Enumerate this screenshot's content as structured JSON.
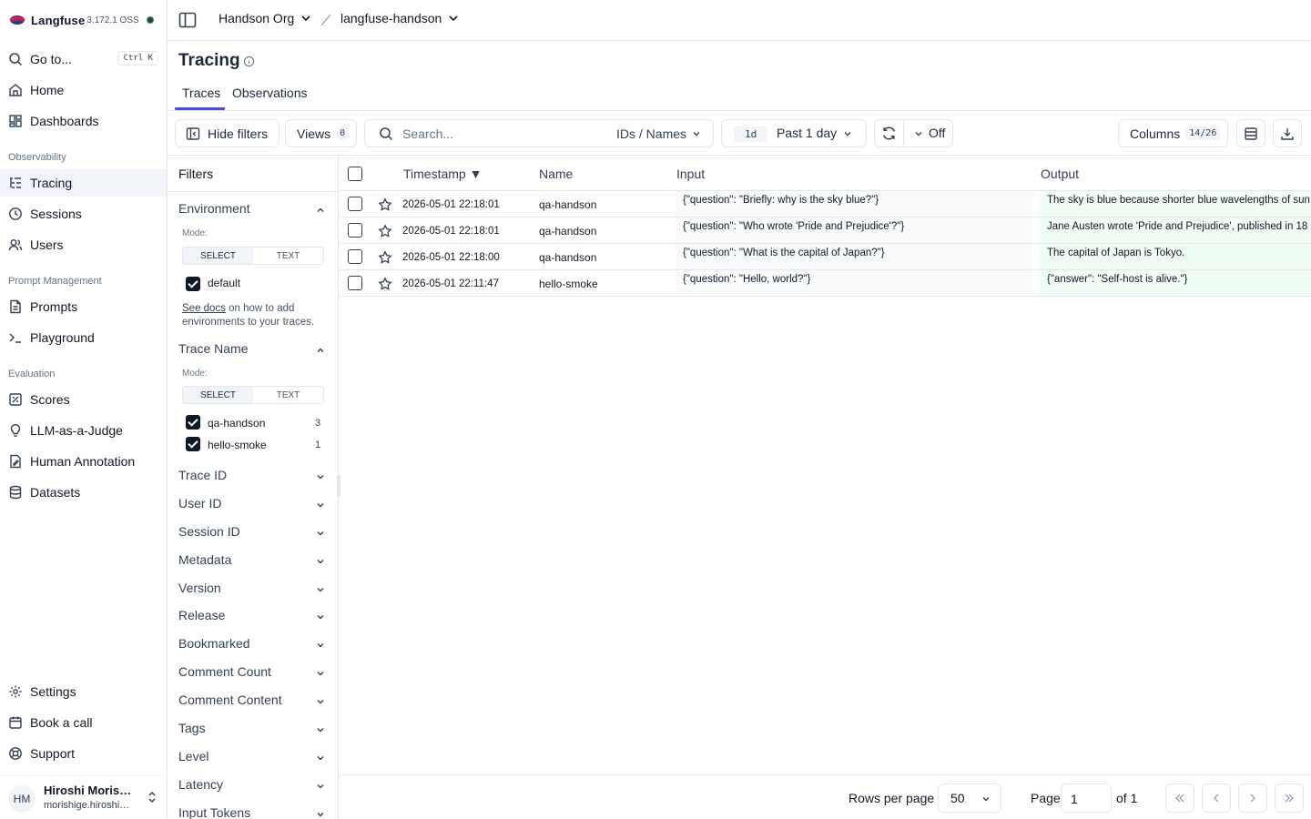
{
  "brand": {
    "name": "Langfuse",
    "version": "3.172.1 OSS"
  },
  "sidebar": {
    "goto": {
      "label": "Go to...",
      "shortcut": "Ctrl K"
    },
    "items_top": [
      {
        "label": "Home",
        "icon": "home-icon"
      },
      {
        "label": "Dashboards",
        "icon": "dashboard-icon"
      }
    ],
    "sections": {
      "observability": "Observability",
      "prompt_management": "Prompt Management",
      "evaluation": "Evaluation"
    },
    "observability": [
      {
        "label": "Tracing",
        "icon": "tracing-icon",
        "active": true
      },
      {
        "label": "Sessions",
        "icon": "clock-icon"
      },
      {
        "label": "Users",
        "icon": "users-icon"
      }
    ],
    "prompt_management": [
      {
        "label": "Prompts",
        "icon": "file-icon"
      },
      {
        "label": "Playground",
        "icon": "terminal-icon"
      }
    ],
    "evaluation": [
      {
        "label": "Scores",
        "icon": "scores-icon"
      },
      {
        "label": "LLM-as-a-Judge",
        "icon": "lightbulb-icon"
      },
      {
        "label": "Human Annotation",
        "icon": "annotation-icon"
      },
      {
        "label": "Datasets",
        "icon": "database-icon"
      }
    ],
    "bottom": [
      {
        "label": "Settings",
        "icon": "gear-icon"
      },
      {
        "label": "Book a call",
        "icon": "calendar-icon"
      },
      {
        "label": "Support",
        "icon": "lifebuoy-icon"
      }
    ],
    "user": {
      "initials": "HM",
      "name": "Hiroshi Morishige",
      "email": "morishige.hiroshi@example.com"
    }
  },
  "topbar": {
    "org": "Handson Org",
    "project": "langfuse-handson"
  },
  "page": {
    "title": "Tracing",
    "tabs": [
      "Traces",
      "Observations"
    ],
    "active_tab": "Traces"
  },
  "toolbar": {
    "hide_filters": "Hide filters",
    "views": "Views",
    "views_count": "0",
    "search_placeholder": "Search...",
    "search_mode": "IDs / Names",
    "range_badge": "1d",
    "range_label": "Past 1 day",
    "refresh": "Off",
    "columns": "Columns",
    "columns_count": "14/26"
  },
  "filters": {
    "title": "Filters",
    "mode_label": "Mode:",
    "mode_select": "SELECT",
    "mode_text": "TEXT",
    "environment": {
      "label": "Environment",
      "options": [
        {
          "label": "default",
          "checked": true
        }
      ],
      "docs_link": "See docs",
      "docs_text": " on how to add environments to your traces."
    },
    "trace_name": {
      "label": "Trace Name",
      "options": [
        {
          "label": "qa-handson",
          "count": "3",
          "checked": true
        },
        {
          "label": "hello-smoke",
          "count": "1",
          "checked": true
        }
      ]
    },
    "collapsed": [
      "Trace ID",
      "User ID",
      "Session ID",
      "Metadata",
      "Version",
      "Release",
      "Bookmarked",
      "Comment Count",
      "Comment Content",
      "Tags",
      "Level",
      "Latency",
      "Input Tokens"
    ]
  },
  "table": {
    "columns": {
      "timestamp": "Timestamp",
      "name": "Name",
      "input": "Input",
      "output": "Output"
    },
    "rows": [
      {
        "timestamp": "2026-05-01 22:18:01",
        "name": "qa-handson",
        "input": "{\"question\": \"Briefly: why is the sky blue?\"}",
        "output": "The sky is blue because shorter blue wavelengths of sun"
      },
      {
        "timestamp": "2026-05-01 22:18:01",
        "name": "qa-handson",
        "input": "{\"question\": \"Who wrote 'Pride and Prejudice'?\"}",
        "output": "Jane Austen wrote 'Pride and Prejudice', published in 18"
      },
      {
        "timestamp": "2026-05-01 22:18:00",
        "name": "qa-handson",
        "input": "{\"question\": \"What is the capital of Japan?\"}",
        "output": "The capital of Japan is Tokyo."
      },
      {
        "timestamp": "2026-05-01 22:11:47",
        "name": "hello-smoke",
        "input": "{\"question\": \"Hello, world?\"}",
        "output": "{\"answer\": \"Self-host is alive.\"}"
      }
    ]
  },
  "pagination": {
    "rows_per_page_label": "Rows per page",
    "rows_per_page": "50",
    "page_label": "Page",
    "page": "1",
    "of_label": "of 1"
  }
}
